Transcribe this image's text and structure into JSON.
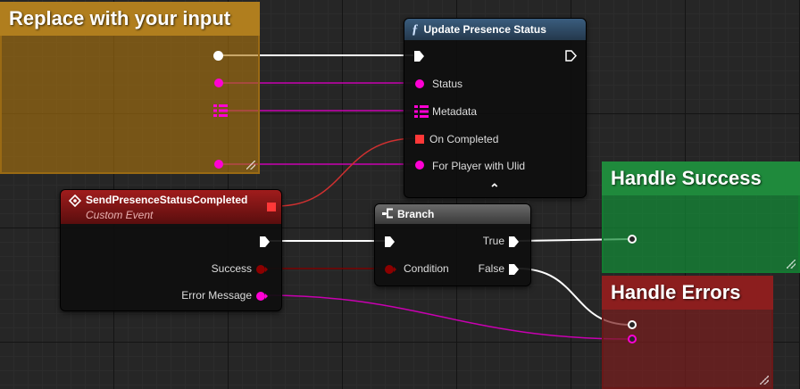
{
  "comments": {
    "input": {
      "title": "Replace with your input",
      "color": "#b07e1e"
    },
    "success": {
      "title": "Handle Success",
      "color": "#1f8a3c"
    },
    "errors": {
      "title": "Handle Errors",
      "color": "#8c1e1e"
    }
  },
  "update_node": {
    "icon": "function-icon",
    "icon_glyph": "ƒ",
    "title": "Update Presence Status",
    "pins": [
      "Status",
      "Metadata",
      "On Completed",
      "For Player with Ulid"
    ],
    "expand_icon": "chevron-up-icon",
    "expand_glyph": "⌃"
  },
  "event_node": {
    "icon": "event-icon",
    "title": "SendPresenceStatusCompleted",
    "subtitle": "Custom Event",
    "pins": [
      "Success",
      "Error Message"
    ]
  },
  "branch_node": {
    "icon": "branch-icon",
    "title": "Branch",
    "pins": [
      "Condition",
      "True",
      "False"
    ]
  },
  "colors": {
    "exec": "#ffffff",
    "string_pin": "#ff00d4",
    "bool_pin": "#8c0000",
    "delegate_pin": "#ff3838",
    "event_header": "#8a1515",
    "function_header": "#2e4a66",
    "branch_header": "#4a4a4a"
  }
}
